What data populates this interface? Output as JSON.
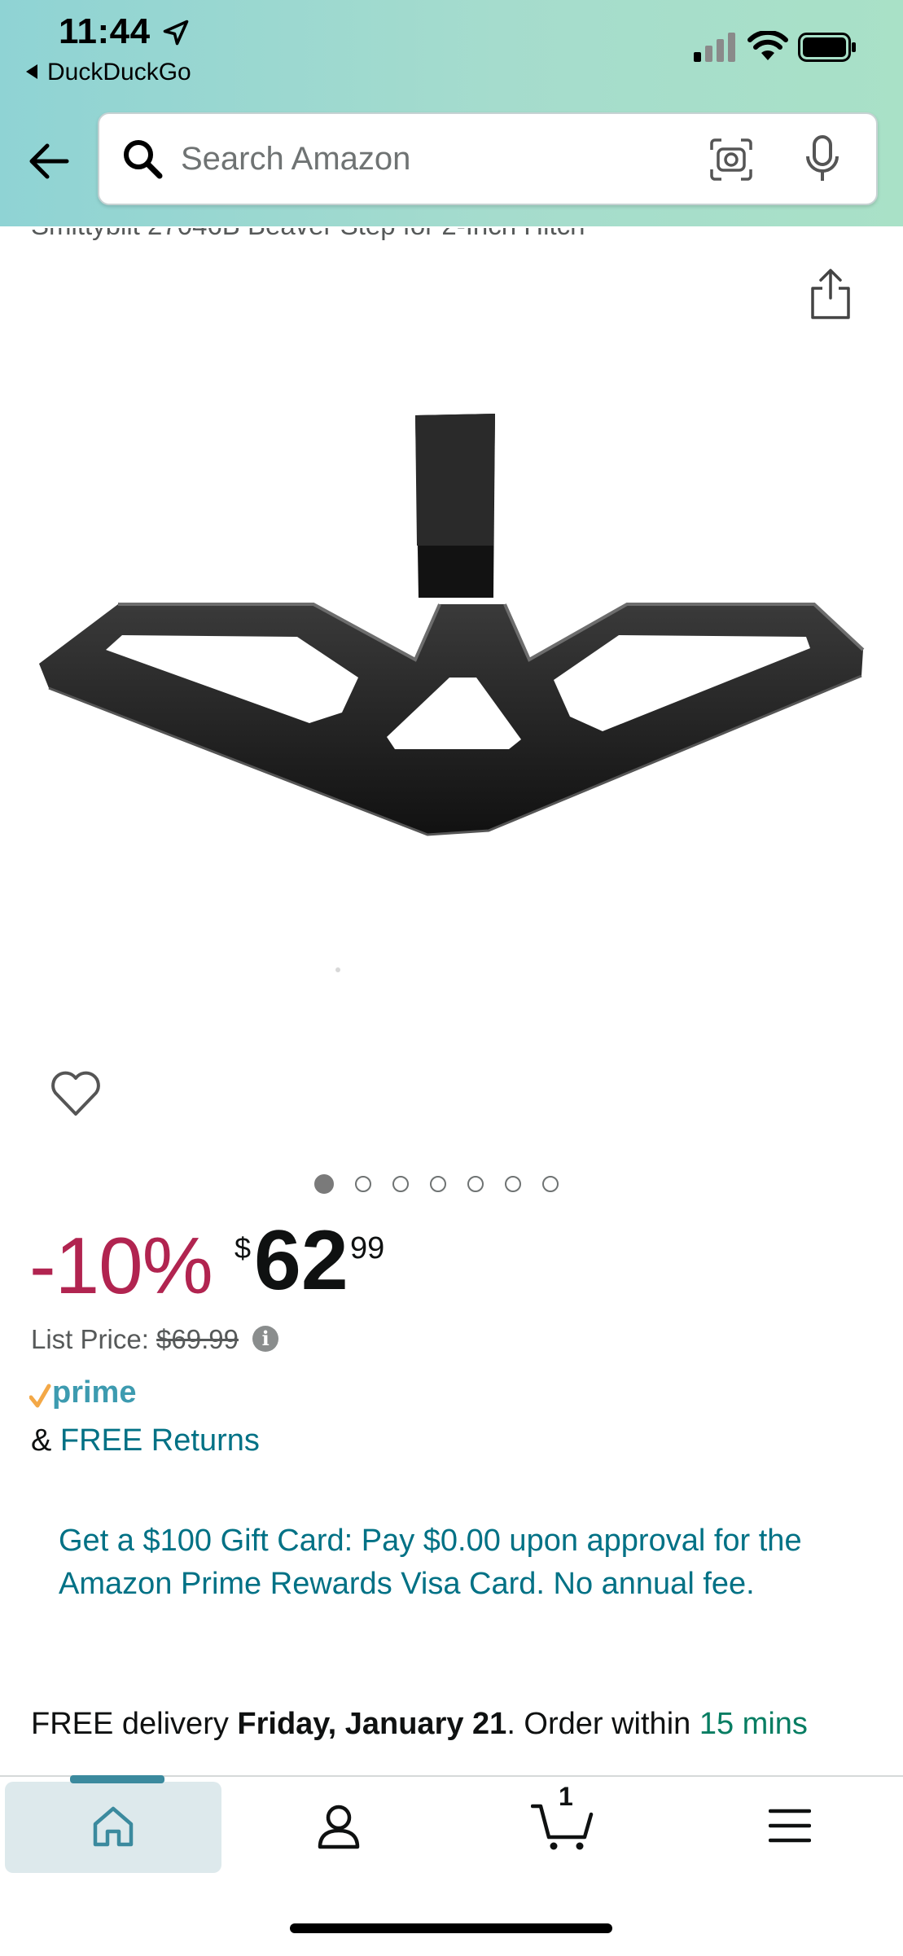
{
  "status_bar": {
    "time": "11:44",
    "back_app": "DuckDuckGo"
  },
  "search": {
    "placeholder": "Search Amazon"
  },
  "product": {
    "title": "Smittybilt 27046B Beaver Step for 2-Inch Hitch",
    "image_count": 7,
    "active_image": 1
  },
  "pricing": {
    "discount": "-10%",
    "currency": "$",
    "whole": "62",
    "fraction": "99",
    "list_price_label": "List Price:",
    "list_price_value": "$69.99"
  },
  "prime": {
    "label": "prime"
  },
  "returns": {
    "prefix": "& ",
    "link": "FREE Returns"
  },
  "promo": {
    "text": "Get a $100 Gift Card: Pay $0.00 upon approval for the Amazon Prime Rewards Visa Card. No annual fee."
  },
  "delivery": {
    "prefix": "FREE delivery ",
    "date": "Friday, January 21",
    "middle": ". Order within ",
    "countdown": "15 mins"
  },
  "bottom_nav": {
    "cart_count": "1",
    "items": [
      "home-icon",
      "account-icon",
      "cart-icon",
      "menu-icon"
    ]
  },
  "colors": {
    "header_start": "#8fd3d4",
    "header_end": "#a9e1c7",
    "discount": "#b12450",
    "link": "#007185",
    "green": "#067d62"
  }
}
